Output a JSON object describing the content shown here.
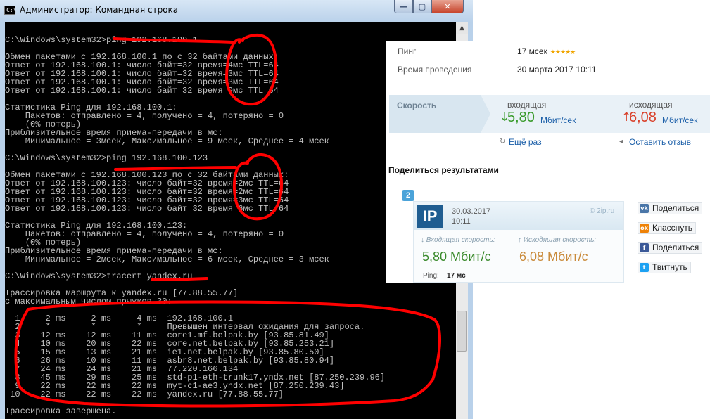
{
  "window": {
    "title": "Администратор: Командная строка",
    "icon": "cmd-icon",
    "icon_text": "C:\\",
    "minimize_glyph": "—",
    "maximize_glyph": "▢",
    "close_glyph": "✕",
    "scroll_up_glyph": "▲"
  },
  "console": {
    "lines": [
      "",
      "C:\\Windows\\system32>ping 192.168.100.1",
      "",
      "Обмен пакетами с 192.168.100.1 по с 32 байтами данных:",
      "Ответ от 192.168.100.1: число байт=32 время=4мс TTL=64",
      "Ответ от 192.168.100.1: число байт=32 время=3мс TTL=64",
      "Ответ от 192.168.100.1: число байт=32 время=3мс TTL=64",
      "Ответ от 192.168.100.1: число байт=32 время=9мс TTL=64",
      "",
      "Статистика Ping для 192.168.100.1:",
      "    Пакетов: отправлено = 4, получено = 4, потеряно = 0",
      "    (0% потерь)",
      "Приблизительное время приема-передачи в мс:",
      "    Минимальное = 3мсек, Максимальное = 9 мсек, Среднее = 4 мсек",
      "",
      "C:\\Windows\\system32>ping 192.168.100.123",
      "",
      "Обмен пакетами с 192.168.100.123 по с 32 байтами данных:",
      "Ответ от 192.168.100.123: число байт=32 время=2мс TTL=64",
      "Ответ от 192.168.100.123: число байт=32 время=2мс TTL=64",
      "Ответ от 192.168.100.123: число байт=32 время=3мс TTL=64",
      "Ответ от 192.168.100.123: число байт=32 время=6мс TTL=64",
      "",
      "Статистика Ping для 192.168.100.123:",
      "    Пакетов: отправлено = 4, получено = 4, потеряно = 0",
      "    (0% потерь)",
      "Приблизительное время приема-передачи в мс:",
      "    Минимальное = 2мсек, Максимальное = 6 мсек, Среднее = 3 мсек",
      "",
      "C:\\Windows\\system32>tracert yandex.ru",
      "",
      "Трассировка маршрута к yandex.ru [77.88.55.77]",
      "с максимальным числом прыжков 30:",
      "",
      "  1     2 ms     2 ms     4 ms  192.168.100.1",
      "  2     *        *        *     Превышен интервал ожидания для запроса.",
      "  3    12 ms    12 ms    11 ms  core1.mf.belpak.by [93.85.81.49]",
      "  4    10 ms    20 ms    22 ms  core.net.belpak.by [93.85.253.21]",
      "  5    15 ms    13 ms    21 ms  ie1.net.belpak.by [93.85.80.50]",
      "  6    26 ms    10 ms    11 ms  asbr8.net.belpak.by [93.85.80.94]",
      "  7    24 ms    24 ms    21 ms  77.220.166.134",
      "  8    45 ms    29 ms    25 ms  std-p1-eth-trunk17.yndx.net [87.250.239.96]",
      "  9    22 ms    22 ms    22 ms  myt-c1-ae3.yndx.net [87.250.239.43]",
      " 10    22 ms    22 ms    22 ms  yandex.ru [77.88.55.77]",
      "",
      "Трассировка завершена."
    ]
  },
  "annotation_color": "#ff0000",
  "speedtest": {
    "ping_label": "Пинг",
    "ping_value": "17 мсек",
    "ping_stars": "★★★★★",
    "date_label": "Время проведения",
    "date_value": "30 марта 2017 10:11",
    "speed_label": "Скорость",
    "download_label": "входящая",
    "download_value": "5,80",
    "download_unit": "Мбит/сек",
    "download_color": "#3a9b2c",
    "upload_label": "исходящая",
    "upload_value": "6,08",
    "upload_unit": "Мбит/сек",
    "upload_color": "#d9412b",
    "retry_label": "Ещё раз",
    "feedback_label": "Оставить отзыв"
  },
  "share": {
    "title": "Поделиться результатами",
    "badge": "2",
    "card": {
      "logo": "IP",
      "date": "30.03.2017",
      "time": "10:11",
      "brand": "© 2ip.ru",
      "download_label": "↓ Входящая скорость:",
      "download_value": "5,80 Мбит/с",
      "upload_label": "↑ Исходящая скорость:",
      "upload_value": "6,08 Мбит/с",
      "ping_label": "Ping:",
      "ping_value": "17 мс"
    },
    "buttons": [
      {
        "label": "Поделиться",
        "icon": "vk-icon",
        "glyph": "vk",
        "color": "#4a76a8"
      },
      {
        "label": "Класснуть",
        "icon": "ok-icon",
        "glyph": "ok",
        "color": "#ee8208"
      },
      {
        "label": "Поделиться",
        "icon": "facebook-icon",
        "glyph": "f",
        "color": "#3b5998"
      },
      {
        "label": "Твитнуть",
        "icon": "twitter-icon",
        "glyph": "t",
        "color": "#1da1f2"
      }
    ]
  }
}
